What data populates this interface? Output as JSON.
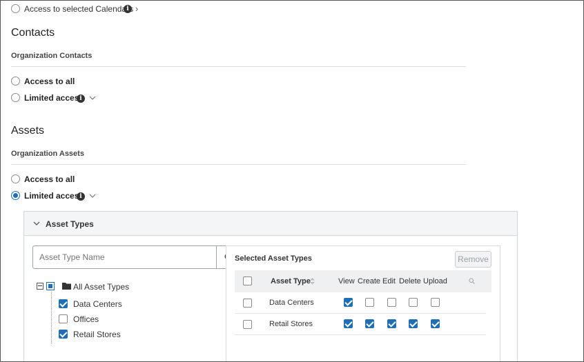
{
  "calendars": {
    "selected_label": "Access to selected Calendars"
  },
  "contacts": {
    "title": "Contacts",
    "subtitle": "Organization Contacts",
    "access_all": "Access to all",
    "limited": "Limited access"
  },
  "assets": {
    "title": "Assets",
    "subtitle": "Organization Assets",
    "access_all": "Access to all",
    "limited": "Limited access",
    "limited_selected": true
  },
  "asset_types_panel": {
    "title": "Asset Types",
    "search_placeholder": "Asset Type Name",
    "tree": {
      "root": "All Asset Types",
      "items": [
        {
          "label": "Data Centers",
          "checked": true
        },
        {
          "label": "Offices",
          "checked": false
        },
        {
          "label": "Retail Stores",
          "checked": true
        }
      ]
    },
    "selected": {
      "title": "Selected Asset Types",
      "remove_label": "Remove",
      "columns": [
        "Asset Type",
        "View",
        "Create",
        "Edit",
        "Delete",
        "Upload"
      ],
      "rows": [
        {
          "name": "Data Centers",
          "perms": [
            true,
            false,
            false,
            false,
            false
          ]
        },
        {
          "name": "Retail Stores",
          "perms": [
            true,
            true,
            true,
            true,
            true
          ]
        }
      ]
    }
  },
  "colors": {
    "accent": "#1e6fb8",
    "panel_bg": "#f4f5f6",
    "border": "#d7dbde"
  },
  "icons": [
    "info-icon",
    "chevron-right-icon",
    "chevron-down-icon",
    "search-icon",
    "folder-icon",
    "sort-icon"
  ]
}
